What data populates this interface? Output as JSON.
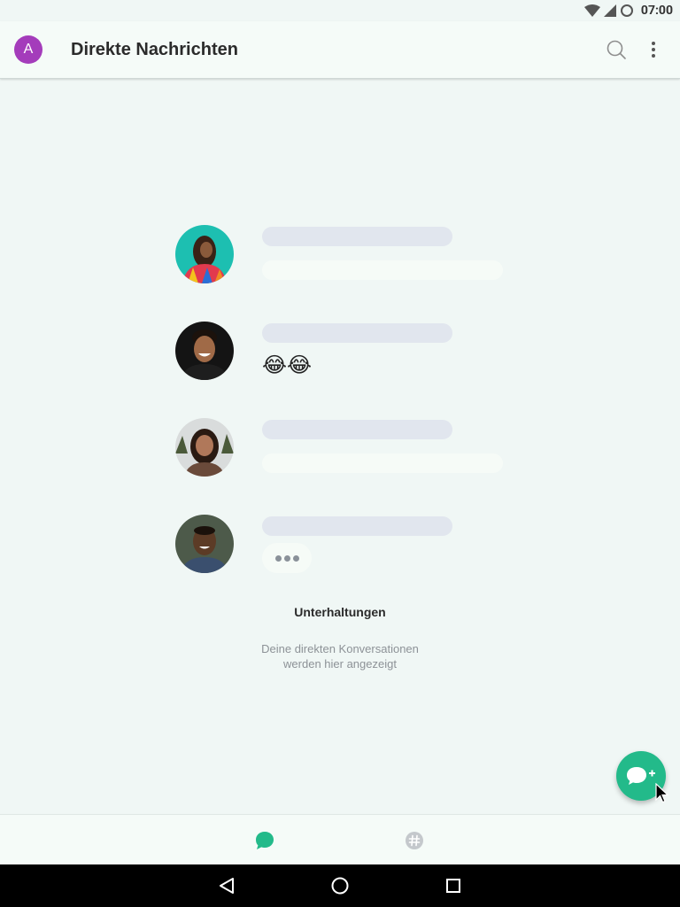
{
  "status_bar": {
    "time": "07:00"
  },
  "app_bar": {
    "avatar_initial": "A",
    "title": "Direkte Nachrichten",
    "search_icon": "search-icon",
    "more_icon": "more-vert-icon"
  },
  "illustration": {
    "rows": [
      {
        "avatar": "avatar-woman-colorful",
        "message_type": "placeholder"
      },
      {
        "avatar": "avatar-man-laughing",
        "message_type": "emoji",
        "emoji": "😂😂"
      },
      {
        "avatar": "avatar-woman-smiling",
        "message_type": "placeholder"
      },
      {
        "avatar": "avatar-man-smiling",
        "message_type": "typing"
      }
    ]
  },
  "empty_state": {
    "title": "Unterhaltungen",
    "subtitle_line1": "Deine direkten Konversationen",
    "subtitle_line2": "werden hier angezeigt"
  },
  "fab": {
    "icon": "new-chat-icon"
  },
  "bottom_nav": {
    "items": [
      {
        "icon": "chat-bubble-icon",
        "active": true
      },
      {
        "icon": "hashtag-icon",
        "active": false
      }
    ]
  },
  "colors": {
    "accent": "#23ba8a",
    "avatar_self": "#a43cbb",
    "background": "#f0f7f5"
  }
}
